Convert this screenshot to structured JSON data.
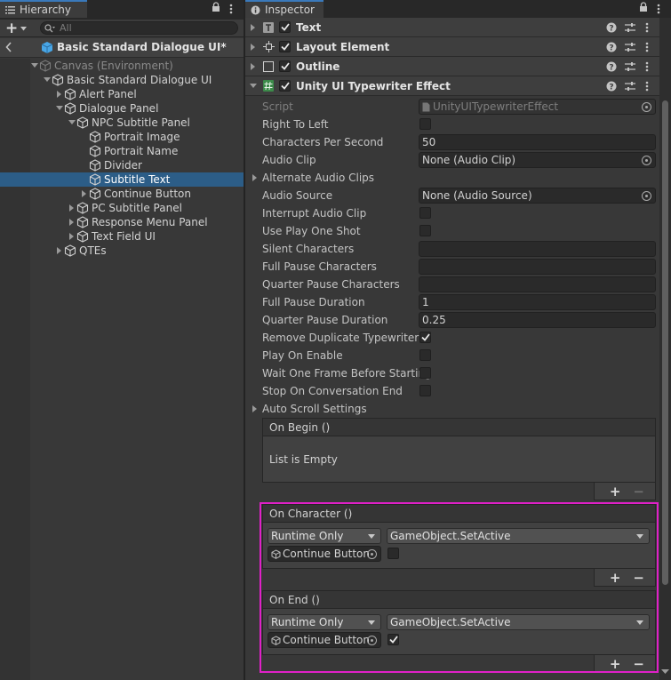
{
  "hierarchy": {
    "tab_label": "Hierarchy",
    "search_placeholder": "All",
    "scene_title": "Basic Standard Dialogue UI*",
    "items": [
      {
        "label": "Canvas (Environment)",
        "depth": 0,
        "fold": "open",
        "dim": true
      },
      {
        "label": "Basic Standard Dialogue UI",
        "depth": 1,
        "fold": "open"
      },
      {
        "label": "Alert Panel",
        "depth": 2,
        "fold": "closed"
      },
      {
        "label": "Dialogue Panel",
        "depth": 2,
        "fold": "open"
      },
      {
        "label": "NPC Subtitle Panel",
        "depth": 3,
        "fold": "open"
      },
      {
        "label": "Portrait Image",
        "depth": 4,
        "fold": "none"
      },
      {
        "label": "Portrait Name",
        "depth": 4,
        "fold": "none"
      },
      {
        "label": "Divider",
        "depth": 4,
        "fold": "none"
      },
      {
        "label": "Subtitle Text",
        "depth": 4,
        "fold": "none",
        "selected": true
      },
      {
        "label": "Continue Button",
        "depth": 4,
        "fold": "closed"
      },
      {
        "label": "PC Subtitle Panel",
        "depth": 3,
        "fold": "closed"
      },
      {
        "label": "Response Menu Panel",
        "depth": 3,
        "fold": "closed"
      },
      {
        "label": "Text Field UI",
        "depth": 3,
        "fold": "closed"
      },
      {
        "label": "QTEs",
        "depth": 2,
        "fold": "closed"
      }
    ]
  },
  "inspector": {
    "tab_label": "Inspector",
    "components": [
      {
        "name": "Text",
        "icon": "text-component-icon"
      },
      {
        "name": "Layout Element",
        "icon": "layout-element-icon"
      },
      {
        "name": "Outline",
        "icon": "outline-component-icon"
      },
      {
        "name": "Unity UI Typewriter Effect",
        "icon": "script-component-icon"
      }
    ],
    "props": [
      {
        "label": "Script",
        "type": "object",
        "value": "UnityUITypewriterEffect",
        "disabled": true
      },
      {
        "label": "Right To Left",
        "type": "check",
        "checked": false
      },
      {
        "label": "Characters Per Second",
        "type": "text",
        "value": "50"
      },
      {
        "label": "Audio Clip",
        "type": "object",
        "value": "None (Audio Clip)"
      },
      {
        "label": "Alternate Audio Clips",
        "type": "foldout"
      },
      {
        "label": "Audio Source",
        "type": "object",
        "value": "None (Audio Source)"
      },
      {
        "label": "Interrupt Audio Clip",
        "type": "check",
        "checked": false
      },
      {
        "label": "Use Play One Shot",
        "type": "check",
        "checked": false
      },
      {
        "label": "Silent Characters",
        "type": "text",
        "value": ""
      },
      {
        "label": "Full Pause Characters",
        "type": "text",
        "value": ""
      },
      {
        "label": "Quarter Pause Characters",
        "type": "text",
        "value": ""
      },
      {
        "label": "Full Pause Duration",
        "type": "text",
        "value": "1"
      },
      {
        "label": "Quarter Pause Duration",
        "type": "text",
        "value": "0.25"
      },
      {
        "label": "Remove Duplicate Typewriter E",
        "type": "check",
        "checked": true
      },
      {
        "label": "Play On Enable",
        "type": "check",
        "checked": false
      },
      {
        "label": "Wait One Frame Before Starting",
        "type": "check",
        "checked": false
      },
      {
        "label": "Stop On Conversation End",
        "type": "check",
        "checked": false
      },
      {
        "label": "Auto Scroll Settings",
        "type": "foldout"
      }
    ],
    "on_begin": {
      "title": "On Begin ()",
      "empty_text": "List is Empty"
    },
    "on_character": {
      "title": "On Character ()",
      "mode": "Runtime Only",
      "function": "GameObject.SetActive",
      "target": "Continue Button",
      "arg_checked": false
    },
    "on_end": {
      "title": "On End ()",
      "mode": "Runtime Only",
      "function": "GameObject.SetActive",
      "target": "Continue Button",
      "arg_checked": true
    },
    "plus": "+",
    "minus": "−"
  },
  "colors": {
    "highlight": "#e020c8",
    "selection": "#2c5d87",
    "tab_accent": "#3a79bb"
  }
}
